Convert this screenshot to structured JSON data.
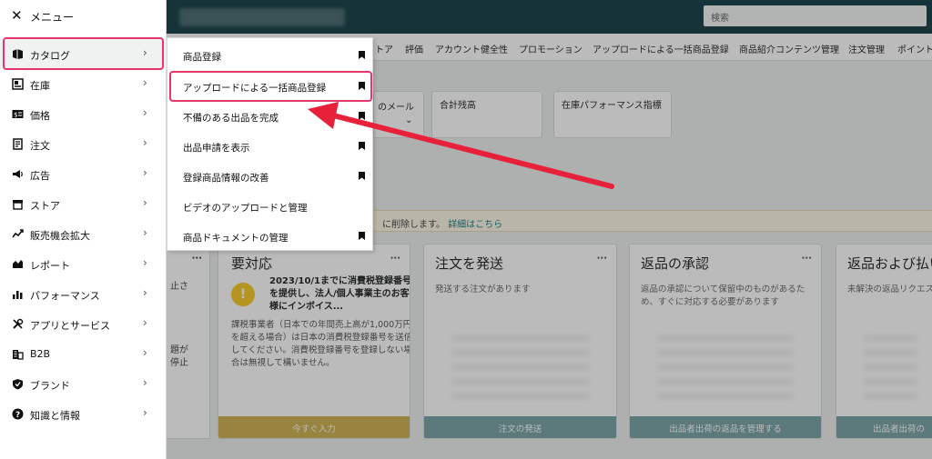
{
  "menu": {
    "title": "メニュー",
    "items": [
      {
        "label": "カタログ",
        "icon": "catalog-icon",
        "active": true
      },
      {
        "label": "在庫",
        "icon": "inventory-icon"
      },
      {
        "label": "価格",
        "icon": "pricing-icon"
      },
      {
        "label": "注文",
        "icon": "orders-icon"
      },
      {
        "label": "広告",
        "icon": "advertising-icon"
      },
      {
        "label": "ストア",
        "icon": "store-icon"
      },
      {
        "label": "販売機会拡大",
        "icon": "growth-icon"
      },
      {
        "label": "レポート",
        "icon": "reports-icon"
      },
      {
        "label": "パフォーマンス",
        "icon": "performance-icon"
      },
      {
        "label": "アプリとサービス",
        "icon": "apps-tools-icon"
      },
      {
        "label": "B2B",
        "icon": "b2b-building-icon"
      },
      {
        "label": "ブランド",
        "icon": "brand-shield-icon"
      },
      {
        "label": "知識と情報",
        "icon": "help-icon"
      }
    ]
  },
  "submenu": {
    "items": [
      {
        "label": "商品登録",
        "bookmark": true
      },
      {
        "label": "アップロードによる一括商品登録",
        "bookmark": true
      },
      {
        "label": "不備のある出品を完成",
        "bookmark": true
      },
      {
        "label": "出品申請を表示",
        "bookmark": true
      },
      {
        "label": "登録商品情報の改善",
        "bookmark": true
      },
      {
        "label": "ビデオのアップロードと管理",
        "bookmark": false
      },
      {
        "label": "商品ドキュメントの管理",
        "bookmark": true
      }
    ]
  },
  "topbar": {
    "search_placeholder": "検索"
  },
  "navbar": {
    "items": [
      "トア",
      "評価",
      "アカウント健全性",
      "プロモーション",
      "アップロードによる一括商品登録",
      "商品紹介コンテンツ管理",
      "注文管理",
      "ポイント"
    ]
  },
  "stats": {
    "mail_label": "のメール",
    "balance_label": "合計残高",
    "inventory_label": "在庫パフォーマンス指標"
  },
  "notice": {
    "text": "に削除します。",
    "link": "詳細はこちら"
  },
  "cards": {
    "left_partial_text": "止さ\n\n\n\n\n題が\n停止",
    "todo": {
      "title": "要対応",
      "headline": "2023/10/1までに消費税登録番号を提供し、法人/個人事業主のお客様にインボイス...",
      "body": "課税事業者（日本での年間売上高が1,000万円を超える場合）は日本の消費税登録番号を送信してください。消費税登録番号を登録しない場合は無視して構いません。",
      "button": "今すぐ入力"
    },
    "ship": {
      "title": "注文を発送",
      "desc": "発送する注文があります",
      "button": "注文の発送"
    },
    "returns": {
      "title": "返品の承認",
      "desc": "返品の承認について保留中のものがあるため、すぐに対応する必要があります",
      "button": "出品者出荷の返品を管理する"
    },
    "returns2": {
      "title": "返品および払い",
      "desc": "未解決の返品リクエス",
      "button": "出品者出荷の"
    }
  },
  "colors": {
    "highlight": "#e8336b",
    "arrow": "#e8213a",
    "card_button": "#6e9a9e",
    "todo_button": "#c9ab3f"
  }
}
